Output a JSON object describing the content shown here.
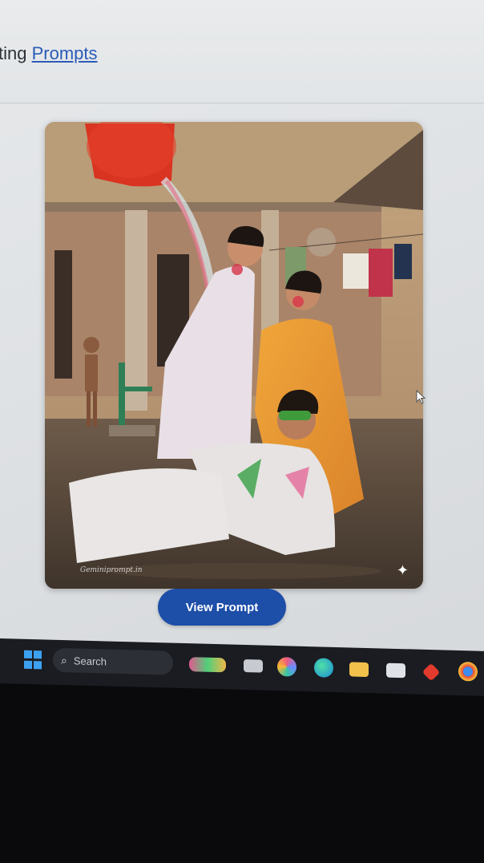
{
  "header": {
    "heading_prefix": "ting ",
    "heading_link": "Prompts"
  },
  "card": {
    "image_alt": "Holi celebration photo",
    "watermark": "Geminiprompt.in",
    "sparkle_icon": "sparkle-icon"
  },
  "actions": {
    "view_prompt_label": "View Prompt"
  },
  "taskbar": {
    "search_placeholder": "Search",
    "icons": [
      "start-icon",
      "search-icon",
      "widgets-icon",
      "taskview-icon",
      "copilot-icon",
      "edge-icon",
      "file-explorer-icon",
      "store-icon",
      "app-icon",
      "chrome-icon"
    ]
  },
  "colors": {
    "link": "#2a5bb8",
    "button": "#1d4ea8",
    "taskbar": "#1a1c22"
  }
}
